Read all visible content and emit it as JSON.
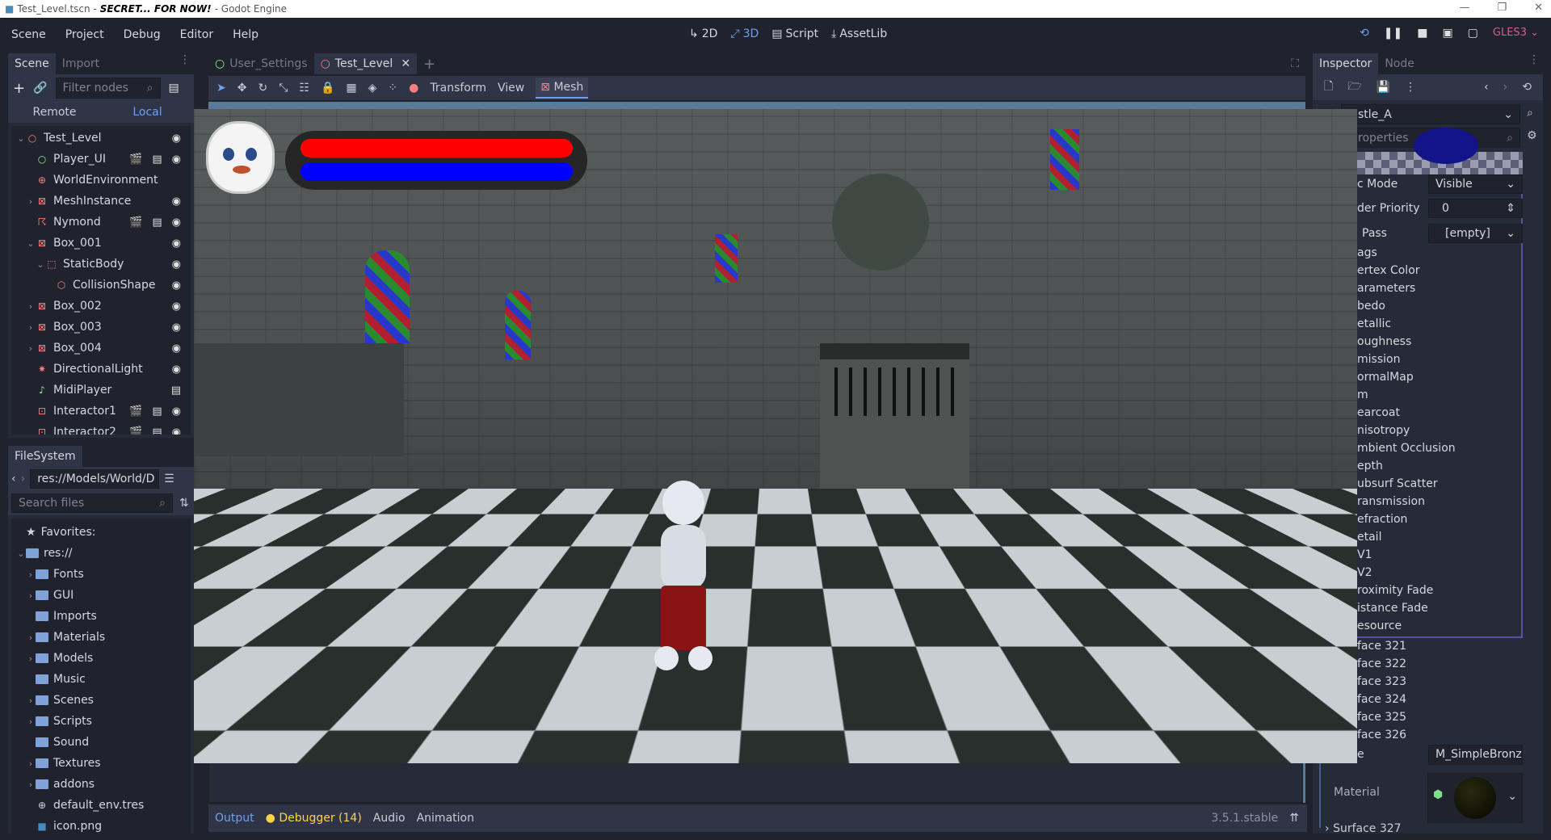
{
  "window": {
    "file": "Test_Level.tscn -",
    "secret": "SECRET... FOR NOW!",
    "suffix": "- Godot Engine",
    "controls": [
      "—",
      "❐",
      "✕"
    ]
  },
  "menu": [
    "Scene",
    "Project",
    "Debug",
    "Editor",
    "Help"
  ],
  "main_screens": [
    {
      "icon": "↳",
      "label": "2D"
    },
    {
      "icon": "⤢",
      "label": "3D"
    },
    {
      "icon": "▤",
      "label": "Script"
    },
    {
      "icon": "⤓",
      "label": "AssetLib"
    }
  ],
  "renderer": "GLES3",
  "scene_dock": {
    "tabs": [
      "Scene",
      "Import"
    ],
    "filter_placeholder": "Filter nodes",
    "remote": "Remote",
    "local": "Local",
    "nodes": [
      {
        "name": "Test_Level",
        "icon": "○",
        "color": "#fc7f7f",
        "depth": 0,
        "arrow": "⌄",
        "eye": true
      },
      {
        "name": "Player_UI",
        "icon": "○",
        "color": "#8eef97",
        "depth": 1,
        "arrow": "",
        "eye": true,
        "scene": true,
        "script": true
      },
      {
        "name": "WorldEnvironment",
        "icon": "⊕",
        "color": "#fc7f7f",
        "depth": 1,
        "arrow": ""
      },
      {
        "name": "MeshInstance",
        "icon": "⊠",
        "color": "#fc7f7f",
        "depth": 1,
        "arrow": "›",
        "eye": true
      },
      {
        "name": "Nymond",
        "icon": "☈",
        "color": "#fc7f7f",
        "depth": 1,
        "arrow": "",
        "eye": true,
        "scene": true,
        "script": true
      },
      {
        "name": "Box_001",
        "icon": "⊠",
        "color": "#fc7f7f",
        "depth": 1,
        "arrow": "⌄",
        "eye": true
      },
      {
        "name": "StaticBody",
        "icon": "⬚",
        "color": "#fc7f7f",
        "depth": 2,
        "arrow": "⌄",
        "eye": true
      },
      {
        "name": "CollisionShape",
        "icon": "⬡",
        "color": "#fc7f7f",
        "depth": 3,
        "arrow": "",
        "eye": true
      },
      {
        "name": "Box_002",
        "icon": "⊠",
        "color": "#fc7f7f",
        "depth": 1,
        "arrow": "›",
        "eye": true
      },
      {
        "name": "Box_003",
        "icon": "⊠",
        "color": "#fc7f7f",
        "depth": 1,
        "arrow": "›",
        "eye": true
      },
      {
        "name": "Box_004",
        "icon": "⊠",
        "color": "#fc7f7f",
        "depth": 1,
        "arrow": "›",
        "eye": true
      },
      {
        "name": "DirectionalLight",
        "icon": "✷",
        "color": "#fc7f7f",
        "depth": 1,
        "arrow": "",
        "eye": true
      },
      {
        "name": "MidiPlayer",
        "icon": "♪",
        "color": "#8eef97",
        "depth": 1,
        "arrow": "",
        "script": true
      },
      {
        "name": "Interactor1",
        "icon": "⊡",
        "color": "#fc7f7f",
        "depth": 1,
        "arrow": "",
        "eye": true,
        "scene": true,
        "script": true
      },
      {
        "name": "Interactor2",
        "icon": "⊡",
        "color": "#fc7f7f",
        "depth": 1,
        "arrow": "",
        "eye": true,
        "scene": true,
        "script": true
      }
    ]
  },
  "filesystem": {
    "tab": "FileSystem",
    "path": "res://Models/World/D",
    "search_placeholder": "Search files",
    "favorites": "Favorites:",
    "root": "res://",
    "items": [
      {
        "name": "Fonts",
        "type": "folder",
        "arrow": "›"
      },
      {
        "name": "GUI",
        "type": "folder",
        "arrow": "›"
      },
      {
        "name": "Imports",
        "type": "folder",
        "arrow": ""
      },
      {
        "name": "Materials",
        "type": "folder",
        "arrow": "›"
      },
      {
        "name": "Models",
        "type": "folder",
        "arrow": "›"
      },
      {
        "name": "Music",
        "type": "folder",
        "arrow": ""
      },
      {
        "name": "Scenes",
        "type": "folder",
        "arrow": "›"
      },
      {
        "name": "Scripts",
        "type": "folder",
        "arrow": "›"
      },
      {
        "name": "Sound",
        "type": "folder",
        "arrow": ""
      },
      {
        "name": "Textures",
        "type": "folder",
        "arrow": "›"
      },
      {
        "name": "addons",
        "type": "folder",
        "arrow": "›"
      },
      {
        "name": "default_env.tres",
        "type": "file",
        "arrow": ""
      },
      {
        "name": "icon.png",
        "type": "image",
        "arrow": ""
      }
    ]
  },
  "editor_tabs": [
    {
      "label": "User_Settings",
      "color": "#8eef97"
    },
    {
      "label": "Test_Level",
      "color": "#fc7f7f",
      "active": true
    }
  ],
  "viewport_toolbar": {
    "transform": "Transform",
    "view": "View",
    "mesh": "Mesh"
  },
  "game_hud": {
    "health": 1.0,
    "mana": 1.0,
    "health_color": "#ff0000",
    "mana_color": "#0000ff"
  },
  "bottom_panel": {
    "tabs": [
      "Output",
      "Debugger (14)",
      "Audio",
      "Animation"
    ],
    "version": "3.5.1.stable"
  },
  "inspector": {
    "tabs": [
      "Inspector",
      "Node"
    ],
    "resource": "stle_A",
    "filter_placeholder": "roperties",
    "mode": {
      "label": "c Mode",
      "value": "Visible"
    },
    "priority": {
      "label": "der Priority",
      "value": "0"
    },
    "pass": {
      "label": "Pass",
      "value": "[empty]"
    },
    "sections": [
      "ags",
      "ertex Color",
      "arameters",
      "bedo",
      "etallic",
      "oughness",
      "mission",
      "ormalMap",
      "m",
      "earcoat",
      "nisotropy",
      "mbient Occlusion",
      "epth",
      "ubsurf Scatter",
      "ransmission",
      "efraction",
      "etail",
      "V1",
      "V2",
      "roximity Fade",
      "istance Fade",
      "esource"
    ],
    "surfaces": [
      "face 321",
      "face 322",
      "face 323",
      "face 324",
      "face 325",
      "face 326"
    ],
    "name_label": "e",
    "name_value": "M_SimpleBronz",
    "material_label": "Material",
    "next_surface": "Surface 327"
  }
}
